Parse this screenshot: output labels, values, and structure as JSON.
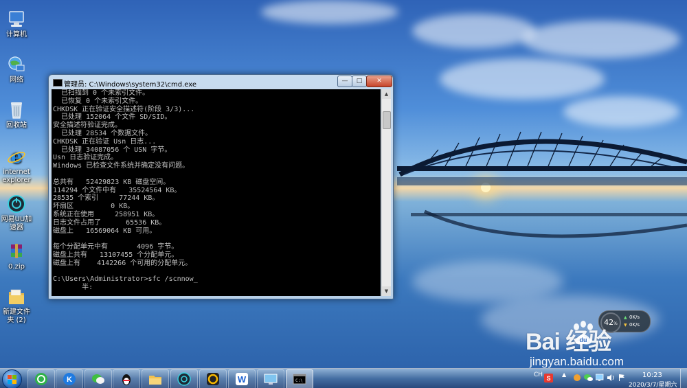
{
  "desktop": {
    "icons": [
      {
        "label": "计算机",
        "icon": "computer-icon"
      },
      {
        "label": "网络",
        "icon": "network-icon"
      },
      {
        "label": "回收站",
        "icon": "recycle-bin-icon"
      },
      {
        "label": "internet explorer",
        "icon": "internet-explorer-icon"
      },
      {
        "label": "网易UU加速器",
        "icon": "uu-accelerator-icon"
      },
      {
        "label": "0.zip",
        "icon": "winrar-archive-icon"
      },
      {
        "label": "新建文件夹 (2)",
        "icon": "folder-icon"
      }
    ]
  },
  "cmd": {
    "title": "管理员: C:\\Windows\\system32\\cmd.exe",
    "buttons": {
      "minimize": "—",
      "maximize": "□",
      "close": "✕"
    },
    "lines": [
      "  已扫描到 0 个未索引文件。",
      "  已恢复 0 个未索引文件。",
      "CHKDSK 正在验证安全描述符(阶段 3/3)...",
      "  已处理 152064 个文件 SD/SID。",
      "安全描述符验证完成。",
      "  已处理 28534 个数据文件。",
      "CHKDSK 正在验证 Usn 日志...",
      "  已处理 34087056 个 USN 字节。",
      "Usn 日志验证完成。",
      "Windows 已检查文件系统并确定没有问题。",
      "",
      "总共有   52429823 KB 磁盘空间。",
      "114294 个文件中有   35524564 KB。",
      "28535 个索引     77244 KB。",
      "坏扇区         0 KB。",
      "系统正在使用     258951 KB。",
      "日志文件占用了      65536 KB。",
      "磁盘上   16569064 KB 可用。",
      "",
      "每个分配单元中有       4096 字节。",
      "磁盘上共有   13107455 个分配单元。",
      "磁盘上有    4142266 个可用的分配单元。",
      "",
      "C:\\Users\\Administrator>sfc /scnnow_",
      "       半:"
    ]
  },
  "taskbar": {
    "apps": [
      {
        "name": "360浏览器",
        "icon": "360-browser-icon"
      },
      {
        "name": "快压",
        "icon": "k-app-icon"
      },
      {
        "name": "微信",
        "icon": "wechat-icon"
      },
      {
        "name": "QQ",
        "icon": "qq-penguin-icon"
      },
      {
        "name": "资源管理器",
        "icon": "file-explorer-icon"
      },
      {
        "name": "网易UU加速器",
        "icon": "uu-accelerator-icon"
      },
      {
        "name": "游戏",
        "icon": "game-app-icon"
      },
      {
        "name": "WPS",
        "icon": "wps-office-icon"
      },
      {
        "name": "远程桌面",
        "icon": "remote-desktop-icon"
      },
      {
        "name": "命令提示符",
        "icon": "cmd-icon"
      }
    ],
    "tray": {
      "ime": "CH",
      "time": "10:23",
      "date": "2020/3/7/星期六"
    }
  },
  "widget": {
    "percent": "42",
    "percent_sign": "%",
    "upload": "0K/s",
    "download": "0K/s"
  },
  "watermark": {
    "brand": "Bai  经验",
    "url": "jingyan.baidu.com"
  },
  "colors": {
    "console_bg": "#000000",
    "console_text": "#c0c0c0",
    "close_button": "#c6442a",
    "taskbar": "#2f5a92"
  }
}
